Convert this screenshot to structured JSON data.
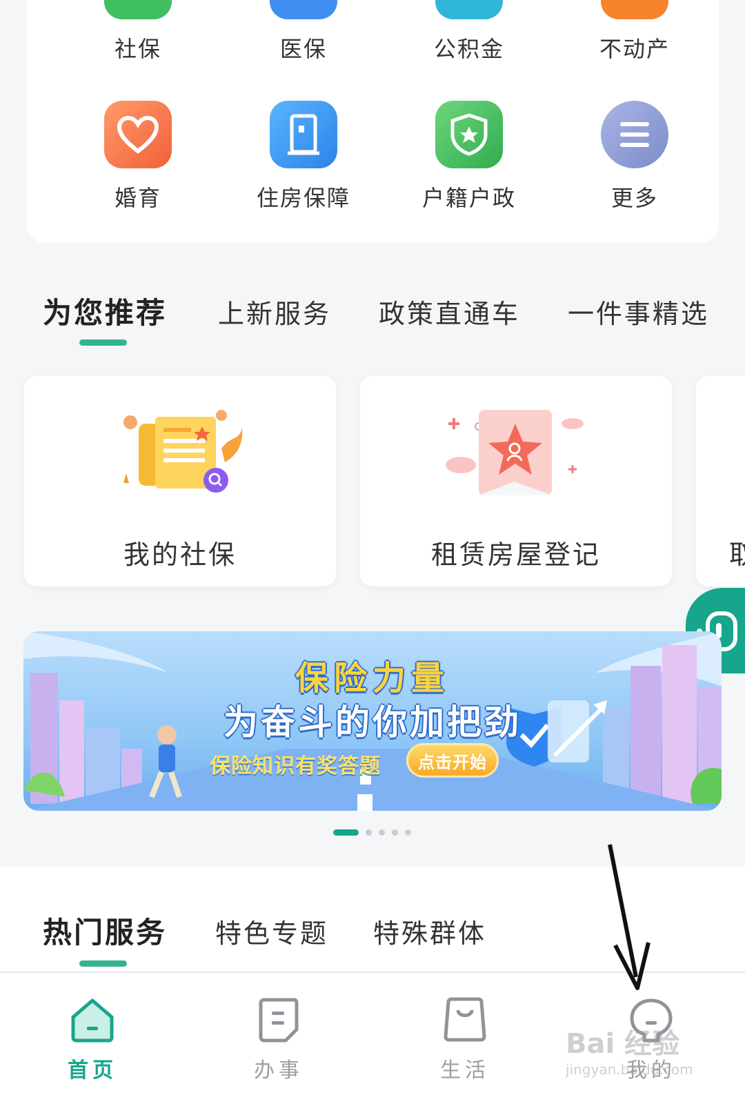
{
  "services": [
    {
      "label": "社保",
      "icon": "social-security-icon",
      "color": "#3fbf62"
    },
    {
      "label": "医保",
      "icon": "medical-insurance-icon",
      "color": "#3f8ff0"
    },
    {
      "label": "公积金",
      "icon": "housing-fund-icon",
      "color": "#2fb6d9"
    },
    {
      "label": "不动产",
      "icon": "real-estate-icon",
      "color": "#f7832c"
    },
    {
      "label": "婚育",
      "icon": "heart-icon",
      "color": "#f7744a"
    },
    {
      "label": "住房保障",
      "icon": "door-icon",
      "color": "#3d95ee"
    },
    {
      "label": "户籍户政",
      "icon": "shield-star-icon",
      "color": "#3dbb5e"
    },
    {
      "label": "更多",
      "icon": "more-icon",
      "color": "#8e9dd6"
    }
  ],
  "rec_tabs": [
    "为您推荐",
    "上新服务",
    "政策直通车",
    "一件事精选"
  ],
  "rec_cards": [
    {
      "title": "我的社保"
    },
    {
      "title": "租赁房屋登记"
    },
    {
      "title": "取"
    }
  ],
  "banner": {
    "title": "保险力量",
    "subtitle": "为奋斗的你加把劲",
    "tagline": "保险知识有奖答题",
    "cta": "点击开始"
  },
  "carousel": {
    "count": 5,
    "active": 0
  },
  "hot_tabs": [
    "热门服务",
    "特色专题",
    "特殊群体"
  ],
  "bottom_nav": [
    {
      "label": "首页",
      "icon": "home-icon",
      "active": true
    },
    {
      "label": "办事",
      "icon": "document-icon",
      "active": false
    },
    {
      "label": "生活",
      "icon": "shopping-bag-icon",
      "active": false
    },
    {
      "label": "我的",
      "icon": "profile-icon",
      "active": false
    }
  ],
  "watermark": {
    "main": "Bai 经验",
    "sub": "jingyan.baidu.com"
  },
  "colors": {
    "accent": "#17a58c",
    "underline": "#34b38f"
  }
}
